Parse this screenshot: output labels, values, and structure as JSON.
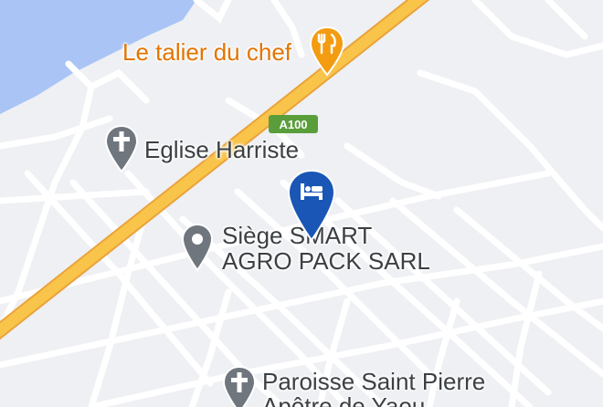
{
  "map": {
    "road_shield": "A100",
    "colors": {
      "background": "#eef0f3",
      "water": "#a9c4f5",
      "road": "#ffffff",
      "highway": "#f9c44a",
      "highway_casing": "#eaa33a",
      "shield": "#5a9e3b",
      "poi_gray": "#6f767d",
      "poi_orange": "#f39c12",
      "hotel_pin": "#1a56b5"
    },
    "pois": [
      {
        "id": "restaurant",
        "label": "Le talier du chef",
        "icon": "fork-knife-icon"
      },
      {
        "id": "church1",
        "label": "Eglise Harriste",
        "icon": "cross-icon"
      },
      {
        "id": "office",
        "label_line1": "Siège SMART",
        "label_line2": "AGRO PACK SARL",
        "icon": "place-pin-icon"
      },
      {
        "id": "church2",
        "label_line1": "Paroisse Saint Pierre",
        "label_line2": "Apôtre de Yaou",
        "icon": "cross-icon"
      }
    ],
    "selected_marker": {
      "icon": "bed-icon",
      "type": "hotel"
    }
  }
}
